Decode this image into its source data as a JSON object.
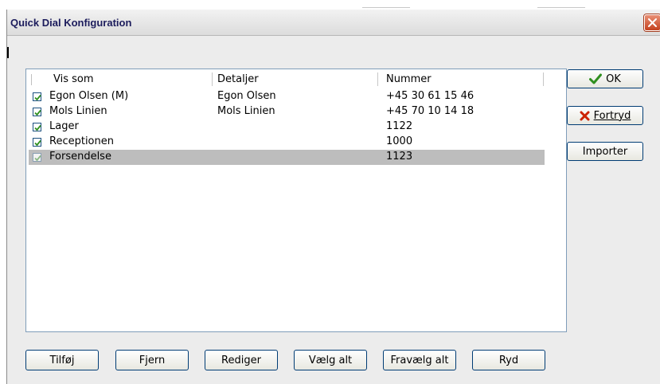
{
  "window": {
    "title": "Quick Dial Konfiguration"
  },
  "list": {
    "columns": [
      "Vis som",
      "Detaljer",
      "Nummer"
    ],
    "rows": [
      {
        "vis_som": "Egon Olsen (M)",
        "detaljer": "Egon Olsen",
        "nummer": "+45 30 61 15 46",
        "checked": true,
        "selected": false
      },
      {
        "vis_som": "Mols Linien",
        "detaljer": "Mols Linien",
        "nummer": "+45 70 10 14 18",
        "checked": true,
        "selected": false
      },
      {
        "vis_som": "Lager",
        "detaljer": "",
        "nummer": "1122",
        "checked": true,
        "selected": false
      },
      {
        "vis_som": "Receptionen",
        "detaljer": "",
        "nummer": "1000",
        "checked": true,
        "selected": false
      },
      {
        "vis_som": "Forsendelse",
        "detaljer": "",
        "nummer": "1123",
        "checked": true,
        "selected": true
      }
    ]
  },
  "side_buttons": {
    "ok_label": "OK",
    "cancel_label": "Fortryd",
    "import_label": "Importer"
  },
  "bottom_buttons": {
    "add": "Tilføj",
    "remove": "Fjern",
    "edit": "Rediger",
    "select_all": "Vælg alt",
    "deselect_all": "Fravælg alt",
    "clear": "Ryd"
  },
  "colors": {
    "check_green": "#2f8f1f",
    "cancel_red": "#cc2200",
    "close_button": "#d5532d",
    "selection_gray": "#bdbdbd"
  },
  "icons": {
    "ok": "green-checkmark-icon",
    "cancel": "red-x-icon",
    "close": "close-icon"
  }
}
